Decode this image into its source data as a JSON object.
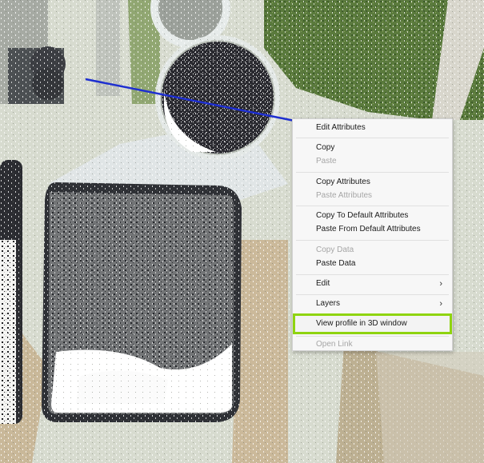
{
  "context_menu": {
    "edit_attributes": "Edit Attributes",
    "copy": "Copy",
    "paste": "Paste",
    "copy_attributes": "Copy Attributes",
    "paste_attributes": "Paste Attributes",
    "copy_to_default_attributes": "Copy To Default Attributes",
    "paste_from_default_attributes": "Paste From Default Attributes",
    "copy_data": "Copy Data",
    "paste_data": "Paste Data",
    "edit": "Edit",
    "layers": "Layers",
    "view_profile": "View profile in 3D window",
    "open_link": "Open Link",
    "submenu_chevron": "›"
  },
  "colors": {
    "highlight_border": "#8fd40f",
    "profile_line": "#1e2fd0",
    "disabled_text": "#a6a6a6"
  }
}
